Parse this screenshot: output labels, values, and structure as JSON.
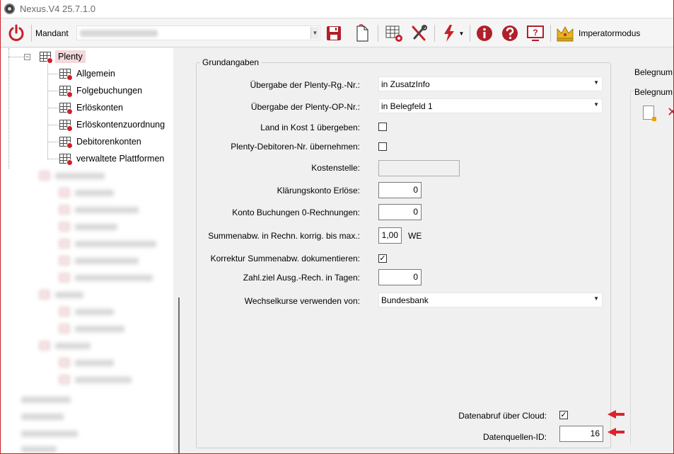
{
  "window": {
    "title": "Nexus.V4 25.7.1.0"
  },
  "toolbar": {
    "mandant_label": "Mandant",
    "mandant_value": "",
    "imperator_label": "Imperatormodus",
    "icons": [
      "power-icon",
      "save-icon",
      "new-document-icon",
      "grid-settings-icon",
      "tools-icon",
      "lightning-icon",
      "info-icon",
      "help-icon",
      "screen-help-icon",
      "crown-icon"
    ]
  },
  "tree": {
    "root": {
      "label": "Plenty"
    },
    "children": [
      {
        "label": "Allgemein"
      },
      {
        "label": "Folgebuchungen"
      },
      {
        "label": "Erlöskonten"
      },
      {
        "label": "Erlöskontenzuordnung"
      },
      {
        "label": "Debitorenkonten"
      },
      {
        "label": "verwaltete Plattformen"
      }
    ]
  },
  "form": {
    "group_title": "Grundangaben",
    "uebergabe_rg_label": "Übergabe der Plenty-Rg.-Nr.:",
    "uebergabe_rg_value": "in ZusatzInfo",
    "uebergabe_op_label": "Übergabe der Plenty-OP-Nr.:",
    "uebergabe_op_value": "in Belegfeld 1",
    "land_kost_label": "Land in Kost 1 übergeben:",
    "land_kost_checked": false,
    "debitoren_label": "Plenty-Debitoren-Nr. übernehmen:",
    "debitoren_checked": false,
    "kostenstelle_label": "Kostenstelle:",
    "kostenstelle_value": "",
    "klaerungskonto_label": "Klärungskonto Erlöse:",
    "klaerungskonto_value": "0",
    "konto_null_label": "Konto Buchungen 0-Rechnungen:",
    "konto_null_value": "0",
    "summenabw_label": "Summenabw. in Rechn. korrig. bis max.:",
    "summenabw_value": "1,00",
    "summenabw_unit": "WE",
    "korrektur_label": "Korrektur Summenabw. dokumentieren:",
    "korrektur_checked": true,
    "zahlziel_label": "Zahl.ziel Ausg.-Rech. in Tagen:",
    "zahlziel_value": "0",
    "wechselkurse_label": "Wechselkurse verwenden von:",
    "wechselkurse_value": "Bundesbank",
    "cloud_label": "Datenabruf über Cloud:",
    "cloud_checked": true,
    "datenquellen_label": "Datenquellen-ID:",
    "datenquellen_value": "16"
  },
  "right_panel": {
    "label1": "Belegnum",
    "label2": "Belegnum"
  },
  "colors": {
    "accent": "#c8202a",
    "selection": "#f3d8dc",
    "arrow": "#e0202a"
  }
}
